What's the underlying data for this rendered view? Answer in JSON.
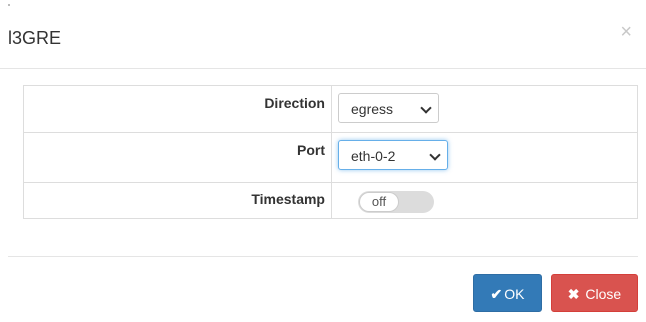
{
  "modal": {
    "title": "l3GRE",
    "close_glyph": "×"
  },
  "form": {
    "direction": {
      "label": "Direction",
      "value": "egress"
    },
    "port": {
      "label": "Port",
      "value": "eth-0-2"
    },
    "timestamp": {
      "label": "Timestamp",
      "state": "off"
    }
  },
  "footer": {
    "ok_icon": "✔",
    "ok_label": "OK",
    "close_icon": "✖",
    "close_label": "Close"
  },
  "colors": {
    "ok": "#337ab7",
    "close": "#d9534f",
    "focus": "#66afe9"
  }
}
